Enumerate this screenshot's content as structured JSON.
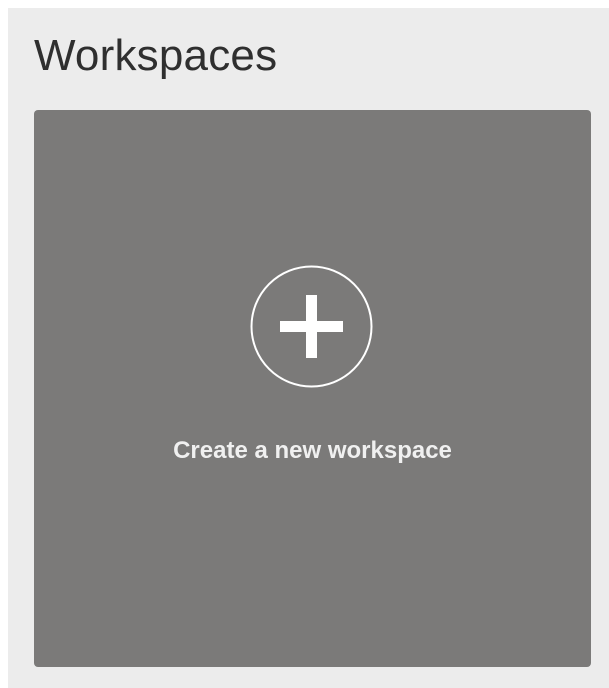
{
  "header": {
    "title": "Workspaces"
  },
  "create_card": {
    "label": "Create a new workspace",
    "icon": "plus-circle-icon"
  },
  "colors": {
    "panel_background": "#ececec",
    "card_background": "#7b7a79",
    "title_text": "#2f2f2f",
    "card_text": "#f0f0f0"
  }
}
